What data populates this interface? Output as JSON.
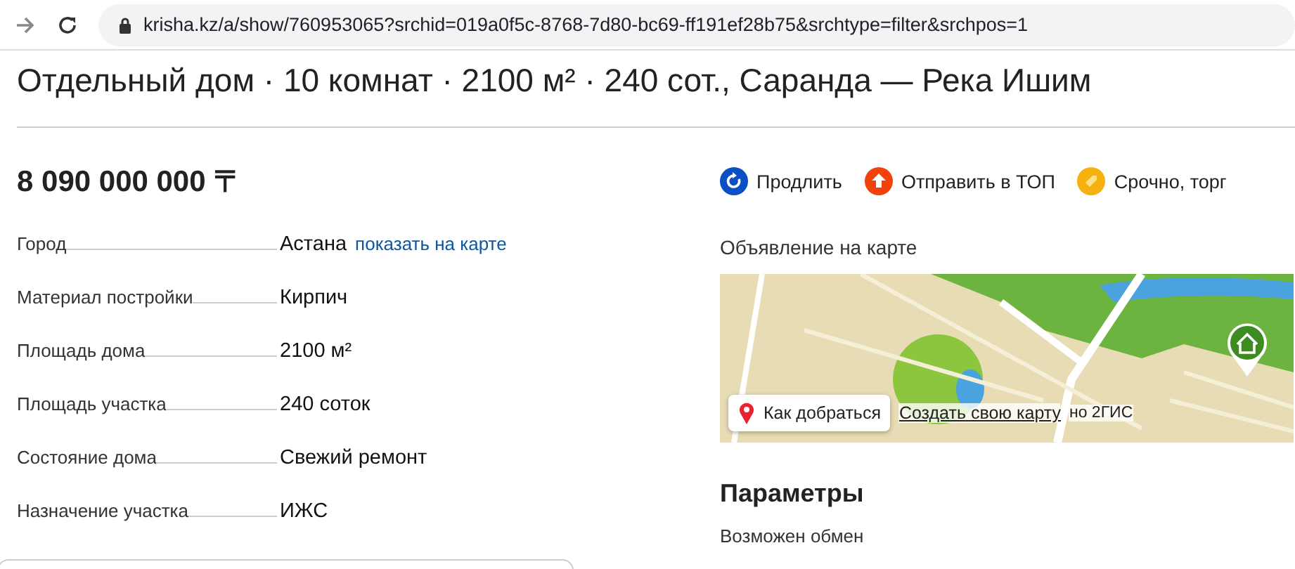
{
  "browser": {
    "url": "krisha.kz/a/show/760953065?srchid=019a0f5c-8768-7d80-bc69-ff191ef28b75&srchtype=filter&srchpos=1"
  },
  "title": "Отдельный дом · 10 комнат · 2100 м² · 240 сот., Саранда — Река Ишим",
  "price": "8 090 000 000 〒",
  "specs": [
    {
      "label": "Город",
      "value": "Астана",
      "link": "показать на карте"
    },
    {
      "label": "Материал постройки",
      "value": "Кирпич"
    },
    {
      "label": "Площадь дома",
      "value": "2100 м²"
    },
    {
      "label": "Площадь участка",
      "value": "240 соток"
    },
    {
      "label": "Состояние дома",
      "value": "Свежий ремонт"
    },
    {
      "label": "Назначение участка",
      "value": "ИЖС"
    }
  ],
  "actions": [
    {
      "kind": "renew",
      "label": "Продлить",
      "color": "#0a4fc4"
    },
    {
      "kind": "top",
      "label": "Отправить в ТОП",
      "color": "#f0420a"
    },
    {
      "kind": "urgent",
      "label": "Срочно, торг",
      "color": "#f5b20e"
    }
  ],
  "map": {
    "heading": "Объявление на карте",
    "route_button": "Как добраться",
    "create_link": "Создать свою карту",
    "attribution": "но 2ГИС"
  },
  "parameters": {
    "heading": "Параметры",
    "items": [
      "Возможен обмен"
    ]
  }
}
